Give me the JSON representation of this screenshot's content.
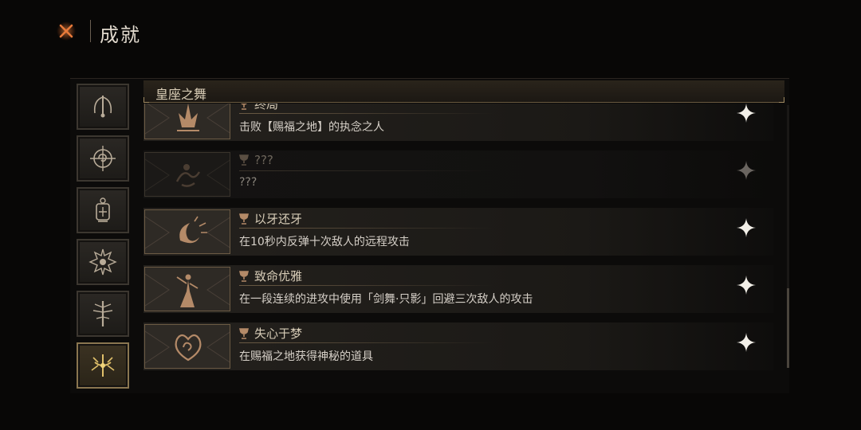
{
  "header": {
    "title": "成就",
    "close_icon": "close-x-icon",
    "accent_color": "#e0703a"
  },
  "sidebar": {
    "tabs": [
      {
        "icon": "arch-blade-icon",
        "active": false
      },
      {
        "icon": "compass-swirl-icon",
        "active": false
      },
      {
        "icon": "lantern-icon",
        "active": false
      },
      {
        "icon": "spiked-eye-icon",
        "active": false
      },
      {
        "icon": "sword-tree-icon",
        "active": false
      },
      {
        "icon": "radiant-crown-icon",
        "active": true
      }
    ]
  },
  "category": {
    "title": "皇座之舞"
  },
  "achievements": [
    {
      "title": "终局",
      "desc": "击败【赐福之地】的执念之人",
      "locked": false,
      "thumb_icon": "crown-spire-icon"
    },
    {
      "title": "???",
      "desc": "???",
      "locked": true,
      "thumb_icon": "swirl-figure-icon"
    },
    {
      "title": "以牙还牙",
      "desc": "在10秒内反弹十次敌人的远程攻击",
      "locked": false,
      "thumb_icon": "crescent-burst-icon"
    },
    {
      "title": "致命优雅",
      "desc": "在一段连续的进攻中使用「剑舞·只影」回避三次敌人的攻击",
      "locked": false,
      "thumb_icon": "dancer-icon"
    },
    {
      "title": "失心于梦",
      "desc": "在赐福之地获得神秘的道具",
      "locked": false,
      "thumb_icon": "spiral-heart-icon"
    }
  ],
  "icons": {
    "trophy": "goblet-icon",
    "star": "four-point-star-icon"
  }
}
